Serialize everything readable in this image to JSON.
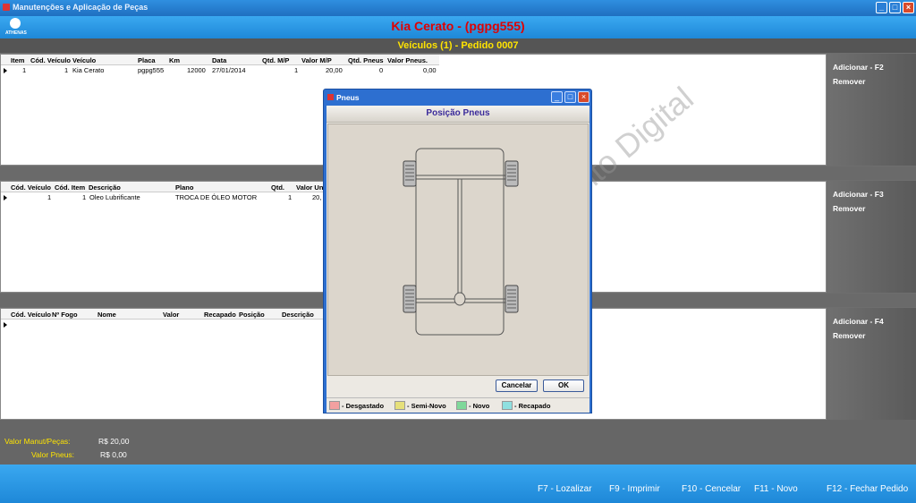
{
  "window": {
    "title": "Manutenções e Aplicação de Peças"
  },
  "header": {
    "vehicle_title": "Kia Cerato - (pgpg555)",
    "logo_text": "ATHENAS"
  },
  "subheader": {
    "text": "Veículos (1) - Pedido 0007"
  },
  "vehicles": {
    "columns": [
      "Item",
      "Cód. Veículo",
      "Veículo",
      "Placa",
      "Km",
      "Data",
      "Qtd. M/P",
      "Valor M/P",
      "Qtd. Pneus",
      "Valor Pneus."
    ],
    "rows": [
      {
        "item": "1",
        "cod": "1",
        "veiculo": "Kia Cerato",
        "placa": "pgpg555",
        "km": "12000",
        "data": "27/01/2014",
        "qtd_mp": "1",
        "valor_mp": "20,00",
        "qtd_pneus": "0",
        "valor_pneus": "0,00"
      }
    ],
    "add_label": "Adicionar - F2",
    "remove_label": "Remover"
  },
  "parts": {
    "columns": [
      "Cód. Veículo",
      "Cód. Item",
      "Descrição",
      "Plano",
      "Qtd.",
      "Valor Un"
    ],
    "rows": [
      {
        "cod_veiculo": "1",
        "cod_item": "1",
        "descricao": "Oleo Lubrificante",
        "plano": "TROCA DE ÓLEO MOTOR",
        "qtd": "1",
        "valor": "20,"
      }
    ],
    "add_label": "Adicionar - F3",
    "remove_label": "Remover"
  },
  "tires": {
    "columns": [
      "Cód. Veículo",
      "Nº Fogo",
      "Nome",
      "Valor",
      "Recapado",
      "Posição",
      "Descrição"
    ],
    "add_label": "Adicionar - F4",
    "remove_label": "Remover"
  },
  "totals": {
    "manut_label": "Valor Manut/Peças:",
    "manut_value": "R$ 20,00",
    "pneus_label": "Valor Pneus:",
    "pneus_value": "R$ 0,00"
  },
  "footer": {
    "keys": [
      "F7 - Lozalizar",
      "F9 - Imprimir",
      "F10 - Cencelar",
      "F11 - Novo",
      "F12 - Fechar Pedido"
    ]
  },
  "dialog": {
    "title": "Pneus",
    "heading": "Posição Pneus",
    "cancel_label": "Cancelar",
    "ok_label": "OK",
    "legend": [
      {
        "label": "- Desgastado",
        "color": "#f2a0a0"
      },
      {
        "label": "- Semi-Novo",
        "color": "#e6e07a"
      },
      {
        "label": "- Novo",
        "color": "#7fd89a"
      },
      {
        "label": "- Recapado",
        "color": "#8fe0e0"
      }
    ]
  },
  "watermark": "Ponto Digital"
}
